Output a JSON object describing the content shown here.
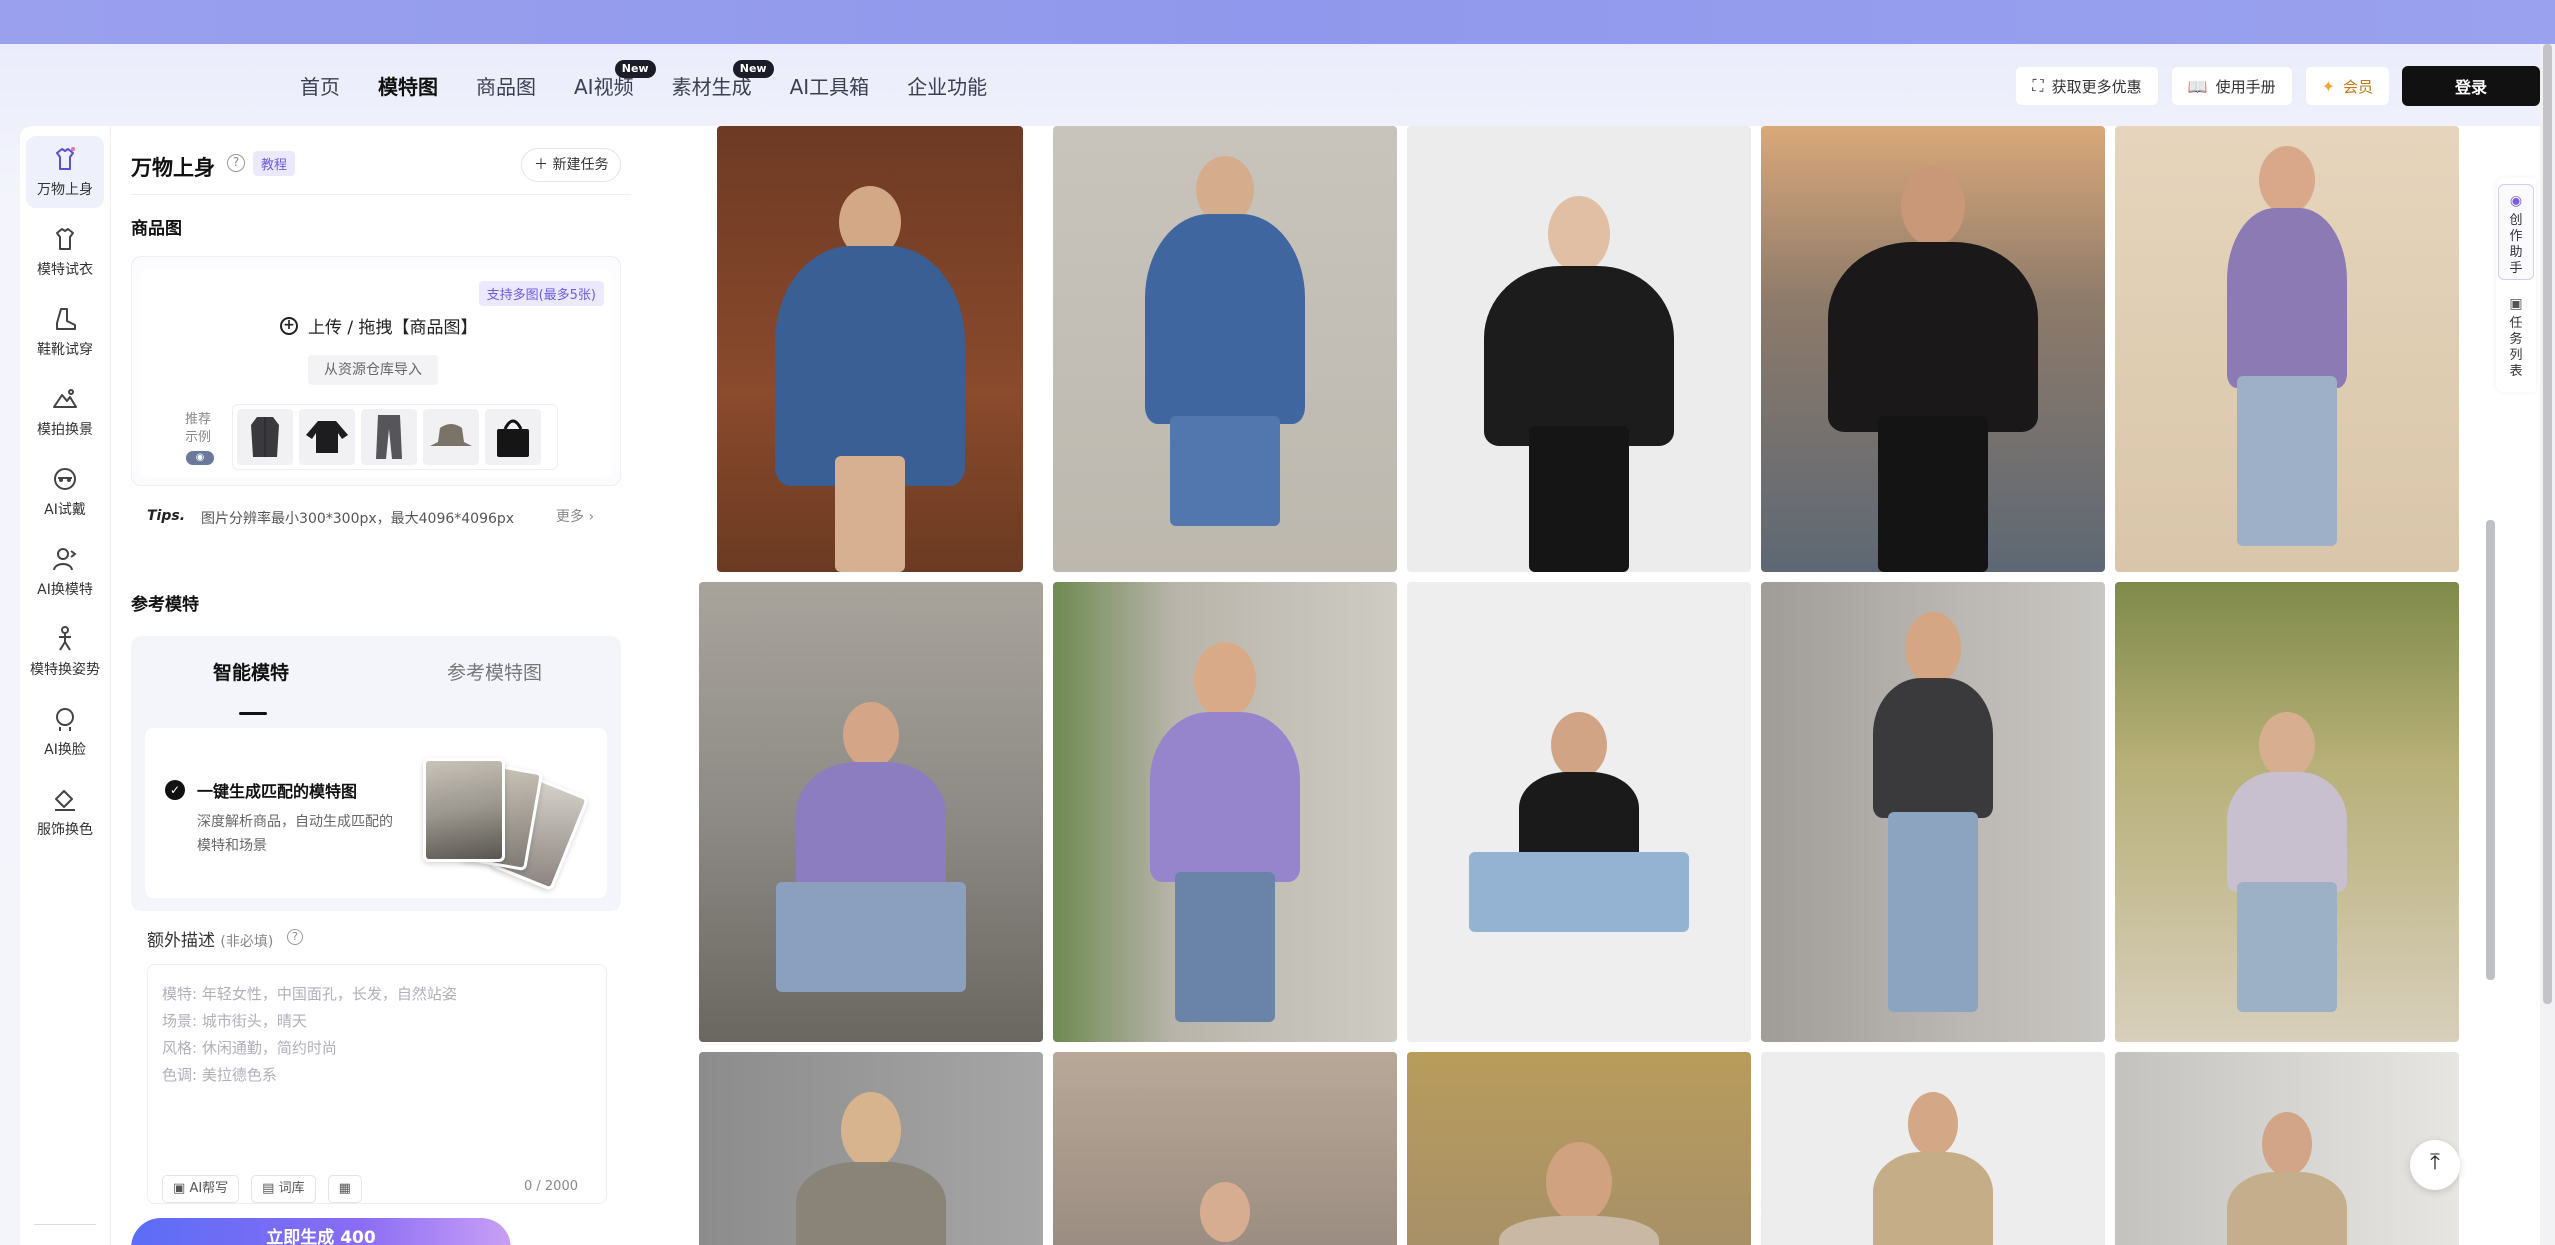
{
  "nav": {
    "items": [
      {
        "label": "首页",
        "active": false,
        "badge": ""
      },
      {
        "label": "模特图",
        "active": true,
        "badge": ""
      },
      {
        "label": "商品图",
        "active": false,
        "badge": ""
      },
      {
        "label": "AI视频",
        "active": false,
        "badge": "New"
      },
      {
        "label": "素材生成",
        "active": false,
        "badge": "New"
      },
      {
        "label": "AI工具箱",
        "active": false,
        "badge": ""
      },
      {
        "label": "企业功能",
        "active": false,
        "badge": ""
      }
    ]
  },
  "header_actions": {
    "deals": "获取更多优惠",
    "manual": "使用手册",
    "vip": "会员",
    "login": "登录"
  },
  "rail": {
    "items": [
      {
        "label": "万物上身",
        "icon": "shirt-sparkle-icon",
        "active": true
      },
      {
        "label": "模特试衣",
        "icon": "shirt-icon",
        "active": false
      },
      {
        "label": "鞋靴试穿",
        "icon": "boot-icon",
        "active": false
      },
      {
        "label": "模拍换景",
        "icon": "mountain-icon",
        "active": false
      },
      {
        "label": "AI试戴",
        "icon": "face-accessory-icon",
        "active": false
      },
      {
        "label": "AI换模特",
        "icon": "person-swap-icon",
        "active": false
      },
      {
        "label": "模特换姿势",
        "icon": "pose-icon",
        "active": false
      },
      {
        "label": "AI换脸",
        "icon": "face-swap-icon",
        "active": false
      },
      {
        "label": "服饰换色",
        "icon": "paint-bucket-icon",
        "active": false
      }
    ]
  },
  "panel": {
    "title": "万物上身",
    "tutorial": "教程",
    "new_task": "新建任务",
    "product_section": "商品图",
    "multi_tag": "支持多图(最多5张)",
    "upload_label": "上传 / 拖拽【商品图】",
    "import_label": "从资源仓库导入",
    "recommend_label": "推荐示例",
    "tips_label": "Tips.",
    "tips_text": "图片分辨率最小300*300px，最大4096*4096px",
    "more": "更多",
    "model_section": "参考模特",
    "tab_smart": "智能模特",
    "tab_ref": "参考模特图",
    "auto_title": "一键生成匹配的模特图",
    "auto_desc": "深度解析商品，自动生成匹配的模特和场景",
    "extra_title": "额外描述",
    "extra_optional": "(非必填)",
    "extra_placeholder": [
      "模特:  年轻女性，中国面孔，长发，自然站姿",
      "场景:  城市街头，晴天",
      "风格:  休闲通勤，简约时尚",
      "色调:  美拉德色系"
    ],
    "tool_write": "AI帮写",
    "tool_lexicon": "词库",
    "counter": "0 / 2000",
    "generate": "立即生成 400"
  },
  "side_tools": {
    "assistant": "创作助手",
    "tasks": "任务列表"
  },
  "colors": {
    "accent": "#5b4fd6",
    "top_band": "#9aa0ee",
    "login_bg": "#111111"
  }
}
